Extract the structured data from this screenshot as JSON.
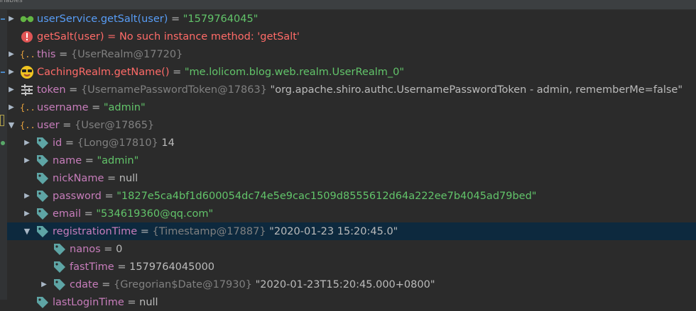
{
  "panel": {
    "title": "ariables"
  },
  "rows": [
    {
      "name": "userService.getSalt(user)",
      "sep": " = ",
      "value": "\"1579764045\""
    },
    {
      "name": "getSalt(user)",
      "sep": " = ",
      "value": "No such instance method: 'getSalt'"
    },
    {
      "name": "this",
      "sep": " = ",
      "ref": "{UserRealm@17720}"
    },
    {
      "name": "CachingRealm.getName()",
      "sep": " = ",
      "value": "\"me.lolicom.blog.web.realm.UserRealm_0\""
    },
    {
      "name": "token",
      "sep": " = ",
      "ref": "{UsernamePasswordToken@17863}",
      "value": "\"org.apache.shiro.authc.UsernamePasswordToken - admin, rememberMe=false\""
    },
    {
      "name": "username",
      "sep": " = ",
      "value": "\"admin\""
    },
    {
      "name": "user",
      "sep": " = ",
      "ref": "{User@17865}"
    },
    {
      "name": "id",
      "sep": " = ",
      "ref": "{Long@17810}",
      "value": "14"
    },
    {
      "name": "name",
      "sep": " = ",
      "value": "\"admin\""
    },
    {
      "name": "nickName",
      "sep": " = ",
      "value": "null"
    },
    {
      "name": "password",
      "sep": " = ",
      "value": "\"1827e5ca4bf1d600054dc74e5e9cac1509d8555612d64a222ee7b4045ad79bed\""
    },
    {
      "name": "email",
      "sep": " = ",
      "value": "\"534619360@qq.com\""
    },
    {
      "name": "registrationTime",
      "sep": " = ",
      "ref": "{Timestamp@17887}",
      "value": "\"2020-01-23 15:20:45.0\""
    },
    {
      "name": "nanos",
      "sep": " = ",
      "value": "0"
    },
    {
      "name": "fastTime",
      "sep": " = ",
      "value": "1579764045000"
    },
    {
      "name": "cdate",
      "sep": " = ",
      "ref": "{Gregorian$Date@17930}",
      "value": "\"2020-01-23T15:20:45.000+0800\""
    },
    {
      "name": "lastLoginTime",
      "sep": " = ",
      "value": "null"
    }
  ],
  "colors": {
    "background": "#2b2b2b",
    "selection": "#0d293e",
    "field_name": "#c77dbb",
    "error": "#ff6b68",
    "string": "#62c46a",
    "ref": "#808080",
    "tag_icon": "#5ea5a5"
  },
  "icons": [
    "watch-glasses-icon",
    "error-icon",
    "object-braces-icon",
    "avatar-icon",
    "token-sliders-icon",
    "field-tag-icon"
  ]
}
